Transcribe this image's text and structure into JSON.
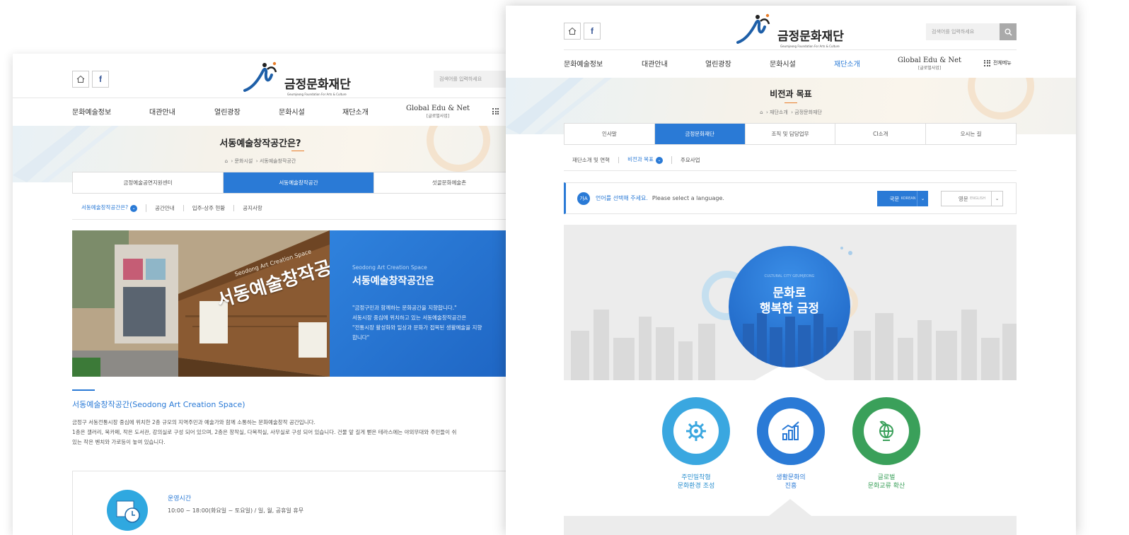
{
  "left_page": {
    "header": {
      "home_icon": "home-icon",
      "facebook_label": "f",
      "logo_text": "금정문화재단",
      "logo_sub": "Geumjeong Foundation For Arts & Culture",
      "search_placeholder": "검색어를 입력하세요"
    },
    "nav": [
      "문화예술정보",
      "대관안내",
      "열린광장",
      "문화시설",
      "재단소개"
    ],
    "nav_global": {
      "label": "Global Edu & Net",
      "sub": "[글로벌사업]"
    },
    "hero": {
      "title": "서동예술창작공간은?",
      "breadcrumb": [
        "문화시설",
        "서동예술창작공간"
      ]
    },
    "tabs": [
      {
        "label": "금정예술공연지원센터",
        "active": false
      },
      {
        "label": "서동예술창작공간",
        "active": true
      },
      {
        "label": "섯골문화예술촌",
        "active": false
      }
    ],
    "subtabs": [
      {
        "label": "서동예술창작공간은?",
        "active": true
      },
      {
        "label": "공간안내",
        "active": false
      },
      {
        "label": "입주-상주 현황",
        "active": false
      },
      {
        "label": "공지사항",
        "active": false
      }
    ],
    "photo_sign": "서동예술창작공간",
    "photo_sign_en": "Seodong Art Creation Space",
    "panel": {
      "en": "Seodong Art Creation Space",
      "title": "서동예술창작공간은",
      "desc": [
        "\"금정구민과 함께하는 문화공간을 지향합니다.\"",
        "서동시장 중심에 위치하고 있는 서동예술창작공간은",
        "\"전통시장 활성화와 일상과 문화가 접목된 생활예술을 지향",
        "합니다\""
      ]
    },
    "section": {
      "title": "서동예술창작공간(Seodong Art Creation Space)",
      "body": [
        "금정구 서동전통시장 중심에 위치한 2층 규모의 지역주민과 예술가와 함께 소통하는 문화예술창작 공간입니다.",
        "1층은 갤러리, 북카페, 작은 도서관, 강의실로 구성 되어 있으며, 2층은 창작실, 다목적실, 사무실로 구성 되어 있습니다. 건물 앞 길게 뻗은 테라스에는 야외무대와 주민들이 쉬",
        "있는 작은 벤치와 가로등이 놓여 있습니다."
      ]
    },
    "info": {
      "title": "운영시간",
      "value": "10:00 ~ 18:00(화요일 ~ 토요일) / 일, 월, 공휴일 휴무"
    }
  },
  "right_page": {
    "header": {
      "logo_text": "금정문화재단",
      "logo_sub": "Geumjeong Foundation For Arts & Culture",
      "search_placeholder": "검색어를 입력하세요",
      "facebook_label": "f"
    },
    "nav": [
      {
        "label": "문화예술정보",
        "active": false
      },
      {
        "label": "대관안내",
        "active": false
      },
      {
        "label": "열린광장",
        "active": false
      },
      {
        "label": "문화시설",
        "active": false
      },
      {
        "label": "재단소개",
        "active": true
      }
    ],
    "nav_global": {
      "label": "Global Edu & Net",
      "sub": "[글로벌사업]"
    },
    "all_menu": "전체메뉴",
    "hero": {
      "title": "비전과 목표",
      "breadcrumb": [
        "재단소개",
        "금정문화재단"
      ]
    },
    "tabs": [
      {
        "label": "인사말",
        "active": false
      },
      {
        "label": "금정문화재단",
        "active": true
      },
      {
        "label": "조직 및 담당업무",
        "active": false
      },
      {
        "label": "CI소개",
        "active": false
      },
      {
        "label": "오시는 길",
        "active": false
      }
    ],
    "subtabs": [
      {
        "label": "재단소개 및 연혁",
        "active": false
      },
      {
        "label": "비전과 목표",
        "active": true
      },
      {
        "label": "주요사업",
        "active": false
      }
    ],
    "lang": {
      "badge": "가A",
      "prompt_ko": "언어를 선택해 주세요.",
      "prompt_en": "Please select a language.",
      "korean": "국문",
      "korean_en": "KOREAN",
      "english": "영문",
      "english_en": "ENGLISH"
    },
    "vision": {
      "kicker": "CULTURAL CITY GEUMJEONG",
      "line1": "문화로",
      "line2": "행복한 금정"
    },
    "pillars": [
      {
        "line1": "주민밀착형",
        "line2": "문화환경 조성",
        "color": "#3aa7e0",
        "icon": "gear-icon"
      },
      {
        "line1": "생활문화의",
        "line2": "진흥",
        "color": "#2a7ad6",
        "icon": "growth-chart-icon"
      },
      {
        "line1": "글로벌",
        "line2": "문화교류 확산",
        "color": "#3aa05a",
        "icon": "globe-plant-icon"
      }
    ]
  }
}
